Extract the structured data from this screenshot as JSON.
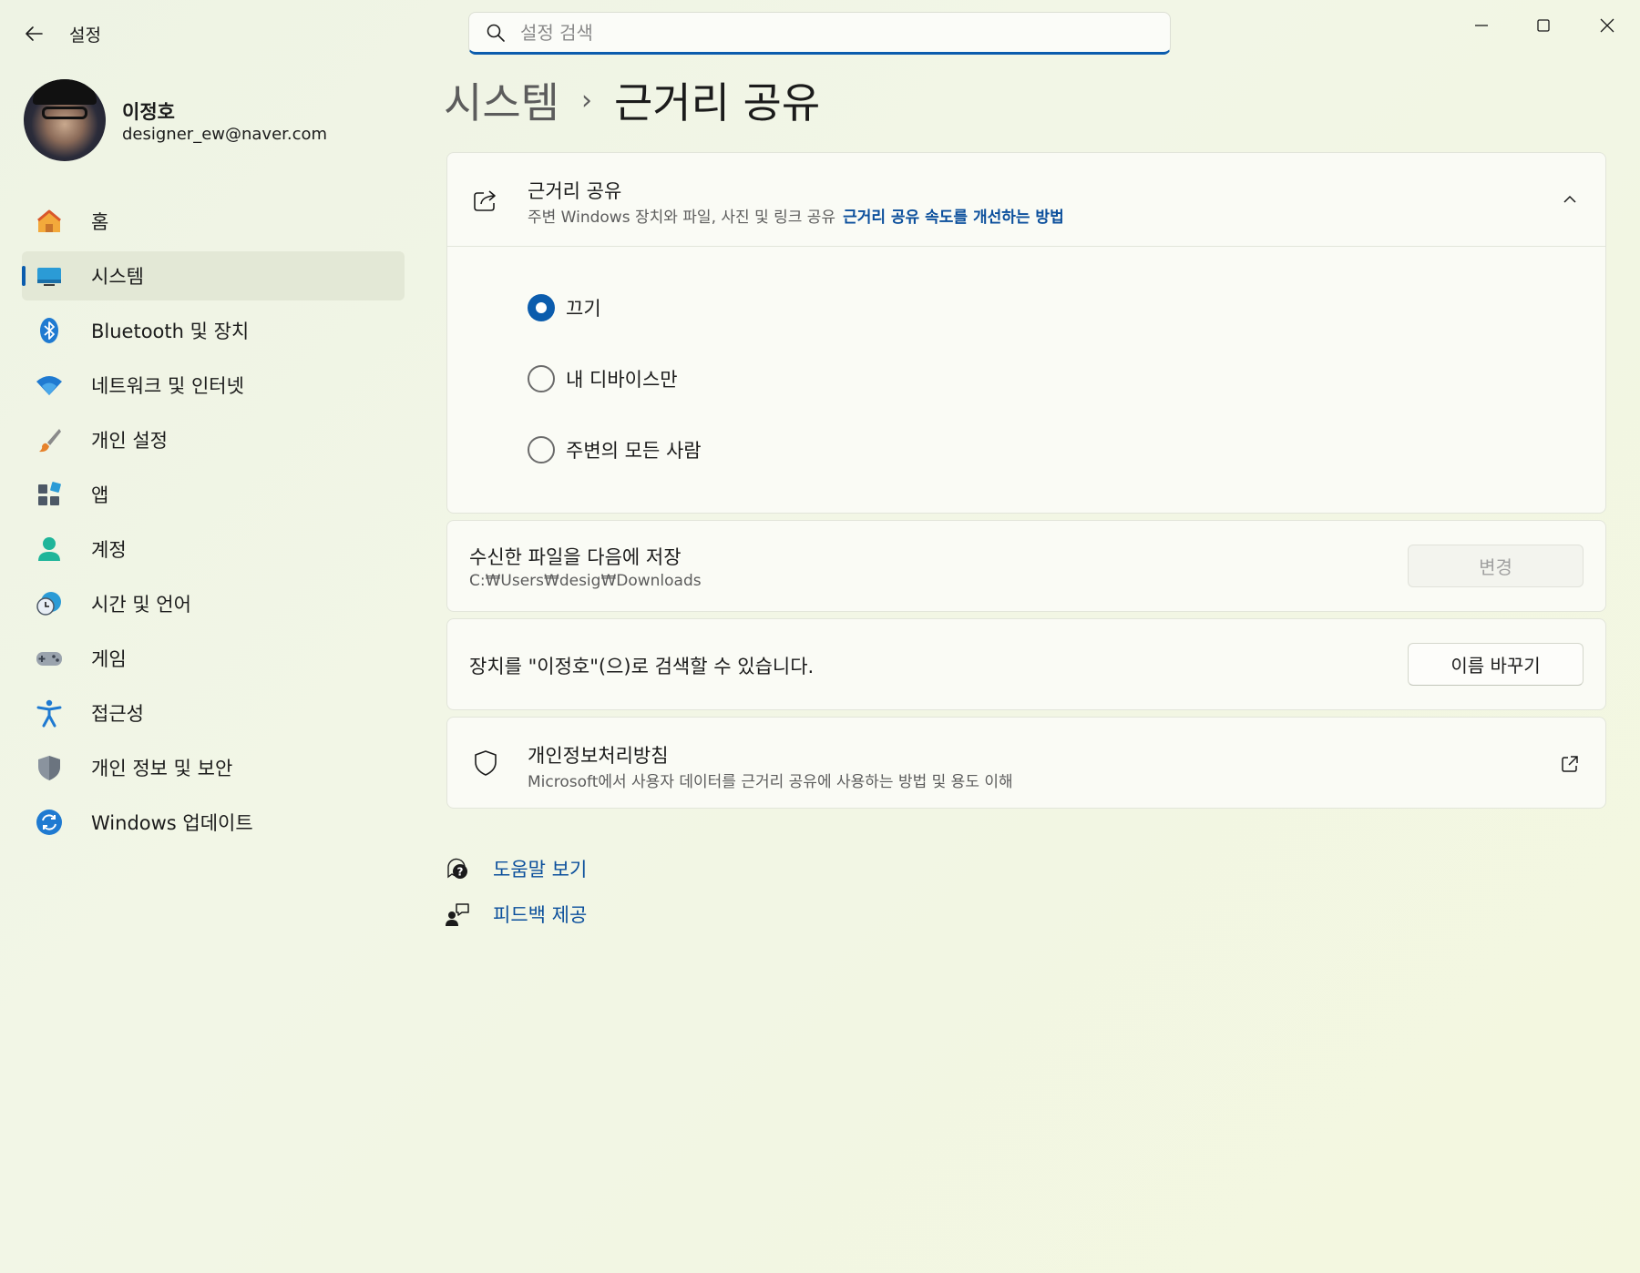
{
  "app": {
    "title": "설정",
    "search_placeholder": "설정 검색"
  },
  "window_controls": [
    "minimize-icon",
    "maximize-icon",
    "close-icon"
  ],
  "profile": {
    "name": "이정호",
    "email": "designer_ew@naver.com"
  },
  "sidebar": {
    "items": [
      {
        "label": "홈",
        "icon": "home-icon",
        "active": false
      },
      {
        "label": "시스템",
        "icon": "system-icon",
        "active": true
      },
      {
        "label": "Bluetooth 및 장치",
        "icon": "bluetooth-icon",
        "active": false
      },
      {
        "label": "네트워크 및 인터넷",
        "icon": "wifi-icon",
        "active": false
      },
      {
        "label": "개인 설정",
        "icon": "brush-icon",
        "active": false
      },
      {
        "label": "앱",
        "icon": "apps-icon",
        "active": false
      },
      {
        "label": "계정",
        "icon": "account-icon",
        "active": false
      },
      {
        "label": "시간 및 언어",
        "icon": "time-language-icon",
        "active": false
      },
      {
        "label": "게임",
        "icon": "gamepad-icon",
        "active": false
      },
      {
        "label": "접근성",
        "icon": "accessibility-icon",
        "active": false
      },
      {
        "label": "개인 정보 및 보안",
        "icon": "shield-icon",
        "active": false
      },
      {
        "label": "Windows 업데이트",
        "icon": "update-icon",
        "active": false
      }
    ]
  },
  "breadcrumb": {
    "parent": "시스템",
    "separator": "›",
    "current": "근거리 공유"
  },
  "nearby_sharing": {
    "title": "근거리 공유",
    "description": "주변 Windows 장치와 파일, 사진 및 링크 공유",
    "link": "근거리 공유 속도를 개선하는 방법",
    "options": [
      {
        "label": "끄기",
        "checked": true
      },
      {
        "label": "내 디바이스만",
        "checked": false
      },
      {
        "label": "주변의 모든 사람",
        "checked": false
      }
    ]
  },
  "save_location": {
    "title": "수신한 파일을 다음에 저장",
    "path": "C:₩Users₩desig₩Downloads",
    "button": "변경"
  },
  "discoverable": {
    "text": "장치를 \"이정호\"(으)로 검색할 수 있습니다.",
    "button": "이름 바꾸기"
  },
  "privacy": {
    "title": "개인정보처리방침",
    "description": "Microsoft에서 사용자 데이터를 근거리 공유에 사용하는 방법 및 용도 이해"
  },
  "links": {
    "help": "도움말 보기",
    "feedback": "피드백 제공"
  },
  "colors": {
    "accent": "#0b5cad",
    "link": "#0b4f9c",
    "background": "#eef3e4"
  }
}
